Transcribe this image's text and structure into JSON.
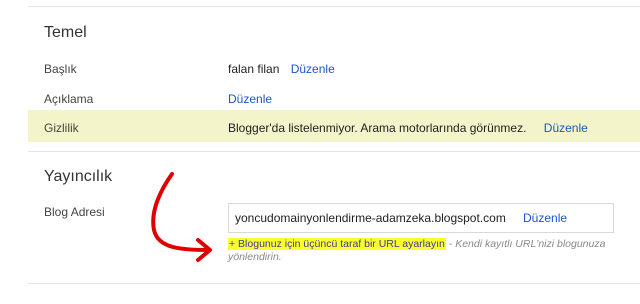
{
  "basic": {
    "title": "Temel",
    "rows": [
      {
        "label": "Başlık",
        "value": "falan filan",
        "action": "Düzenle"
      },
      {
        "label": "Açıklama",
        "value": "",
        "action": "Düzenle"
      },
      {
        "label": "Gizlilik",
        "value": "Blogger'da listelenmiyor. Arama motorlarında görünmez.",
        "action": "Düzenle"
      }
    ]
  },
  "publishing": {
    "title": "Yayıncılık",
    "blog_address_label": "Blog Adresi",
    "blog_address": "yoncudomainyonlendirme-adamzeka.blogspot.com",
    "blog_address_action": "Düzenle",
    "third_party_link": "+ Blogunuz için üçüncü taraf bir URL ayarlayın",
    "hint_text": " - Kendi kayıtlı URL'nizi blogunuza yönlendirin."
  },
  "colors": {
    "link": "#1a55c9",
    "highlight_row": "#f4f4ca",
    "marker_highlight": "#fbff2e",
    "annotation_arrow": "#e00000"
  }
}
